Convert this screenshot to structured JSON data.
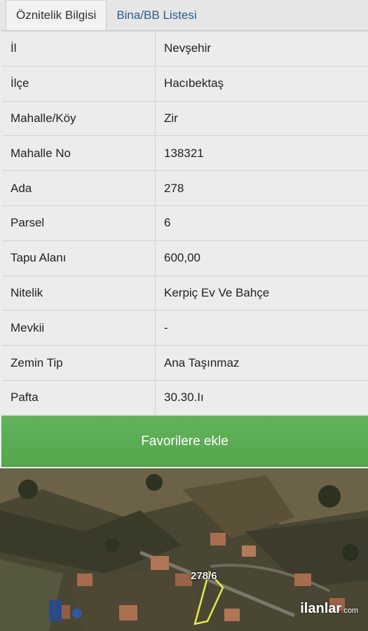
{
  "tabs": [
    {
      "label": "Öznitelik Bilgisi",
      "active": true
    },
    {
      "label": "Bina/BB Listesi",
      "active": false
    }
  ],
  "attributes": [
    {
      "key": "İl",
      "value": "Nevşehir"
    },
    {
      "key": "İlçe",
      "value": "Hacıbektaş"
    },
    {
      "key": "Mahalle/Köy",
      "value": "Zir"
    },
    {
      "key": "Mahalle No",
      "value": "138321"
    },
    {
      "key": "Ada",
      "value": "278"
    },
    {
      "key": "Parsel",
      "value": "6"
    },
    {
      "key": "Tapu Alanı",
      "value": "600,00"
    },
    {
      "key": "Nitelik",
      "value": "Kerpiç Ev Ve Bahçe"
    },
    {
      "key": "Mevkii",
      "value": "-"
    },
    {
      "key": "Zemin Tip",
      "value": "Ana Taşınmaz"
    },
    {
      "key": "Pafta",
      "value": "30.30.Iı"
    }
  ],
  "favorite_button": {
    "label": "Favorilere ekle",
    "color": "#5aac53"
  },
  "map": {
    "parcel_label": "278/6",
    "watermark": "ilanlar",
    "watermark_suffix": ".com"
  }
}
